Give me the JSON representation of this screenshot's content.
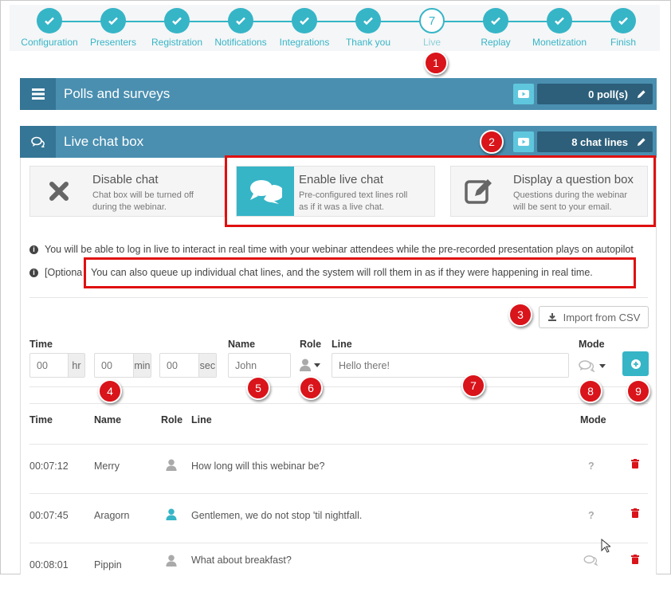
{
  "stepper": {
    "steps": [
      {
        "label": "Configuration",
        "state": "done"
      },
      {
        "label": "Presenters",
        "state": "done"
      },
      {
        "label": "Registration",
        "state": "done"
      },
      {
        "label": "Notifications",
        "state": "done"
      },
      {
        "label": "Integrations",
        "state": "done"
      },
      {
        "label": "Thank you",
        "state": "done"
      },
      {
        "label": "Live",
        "state": "current",
        "number": "7"
      },
      {
        "label": "Replay",
        "state": "done"
      },
      {
        "label": "Monetization",
        "state": "done"
      },
      {
        "label": "Finish",
        "state": "done"
      }
    ]
  },
  "badges": [
    "1",
    "2",
    "3",
    "4",
    "5",
    "6",
    "7",
    "8",
    "9"
  ],
  "polls": {
    "title": "Polls and surveys",
    "count": "0 poll(s)"
  },
  "chat": {
    "title": "Live chat box",
    "count": "8 chat lines"
  },
  "options": [
    {
      "title": "Disable chat",
      "desc1": "Chat box will be turned off",
      "desc2": "during the webinar.",
      "icon": "x-icon"
    },
    {
      "title": "Enable live chat",
      "desc1": "Pre-configured text lines roll",
      "desc2": "as if it was a live chat.",
      "icon": "chat-bubbles-icon"
    },
    {
      "title": "Display a question box",
      "desc1": "Questions during the webinar",
      "desc2": "will be sent to your email.",
      "icon": "edit-icon"
    }
  ],
  "info": {
    "line1": "You will be able to log in live to interact in real time with your webinar attendees while the pre-recorded presentation plays on autopilot",
    "line2_prefix": "[Optiona",
    "line2": "You can also queue up individual chat lines, and the system will roll them in as if they were happening in real time."
  },
  "import_csv": "Import from CSV",
  "form": {
    "time_label": "Time",
    "name_label": "Name",
    "role_label": "Role",
    "line_label": "Line",
    "mode_label": "Mode",
    "hr_placeholder": "00",
    "hr_addon": "hr",
    "min_placeholder": "00",
    "min_addon": "min",
    "sec_placeholder": "00",
    "sec_addon": "sec",
    "name_placeholder": "John",
    "line_placeholder": "Hello there!"
  },
  "table": {
    "headers": {
      "time": "Time",
      "name": "Name",
      "role": "Role",
      "line": "Line",
      "mode": "Mode"
    },
    "rows": [
      {
        "time": "00:07:12",
        "name": "Merry",
        "role_color": "#aaaaaa",
        "line": "How long will this webinar be?",
        "mode": "question"
      },
      {
        "time": "00:07:45",
        "name": "Aragorn",
        "role_color": "#36b5c7",
        "line": "Gentlemen, we do not stop 'til nightfall.",
        "mode": "question"
      },
      {
        "time": "00:08:01",
        "name": "Pippin",
        "role_color": "#aaaaaa",
        "line": "What about breakfast?",
        "mode": "chat"
      }
    ]
  },
  "colors": {
    "accent": "#36b5c7",
    "header": "#4a8fb0",
    "annotation": "#e01010",
    "delete": "#d9141a"
  }
}
